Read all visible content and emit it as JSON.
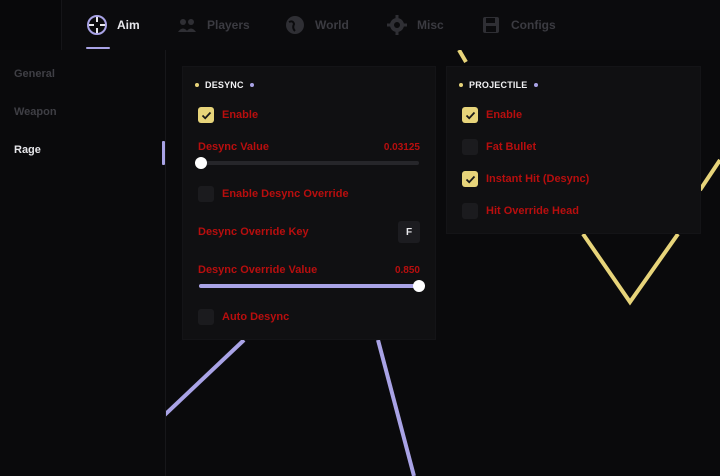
{
  "tabs": [
    {
      "label": "Aim",
      "icon": "crosshair-icon",
      "active": true
    },
    {
      "label": "Players",
      "icon": "users-icon",
      "active": false
    },
    {
      "label": "World",
      "icon": "globe-icon",
      "active": false
    },
    {
      "label": "Misc",
      "icon": "gear-icon",
      "active": false
    },
    {
      "label": "Configs",
      "icon": "save-icon",
      "active": false
    }
  ],
  "sidebar": {
    "items": [
      {
        "label": "General",
        "active": false
      },
      {
        "label": "Weapon",
        "active": false
      },
      {
        "label": "Rage",
        "active": true
      }
    ]
  },
  "desync": {
    "title": "DESYNC",
    "enable": {
      "label": "Enable",
      "checked": true
    },
    "desync_value": {
      "label": "Desync Value",
      "value": "0.03125",
      "fraction": 0.0
    },
    "override_enable": {
      "label": "Enable Desync Override",
      "checked": false
    },
    "override_key": {
      "label": "Desync Override Key",
      "key": "F"
    },
    "override_value": {
      "label": "Desync Override Value",
      "value": "0.850",
      "fraction": 1.0
    },
    "auto": {
      "label": "Auto Desync",
      "checked": false
    }
  },
  "projectile": {
    "title": "PROJECTILE",
    "options": [
      {
        "label": "Enable",
        "checked": true
      },
      {
        "label": "Fat Bullet",
        "checked": false
      },
      {
        "label": "Instant Hit (Desync)",
        "checked": true
      },
      {
        "label": "Hit Override Head",
        "checked": false
      }
    ]
  },
  "colors": {
    "accent_purple": "#a9a3e6",
    "accent_yellow": "#e7d47a",
    "option_red": "#b80e0e",
    "background": "#0a0a0c",
    "panel": "#101012"
  }
}
